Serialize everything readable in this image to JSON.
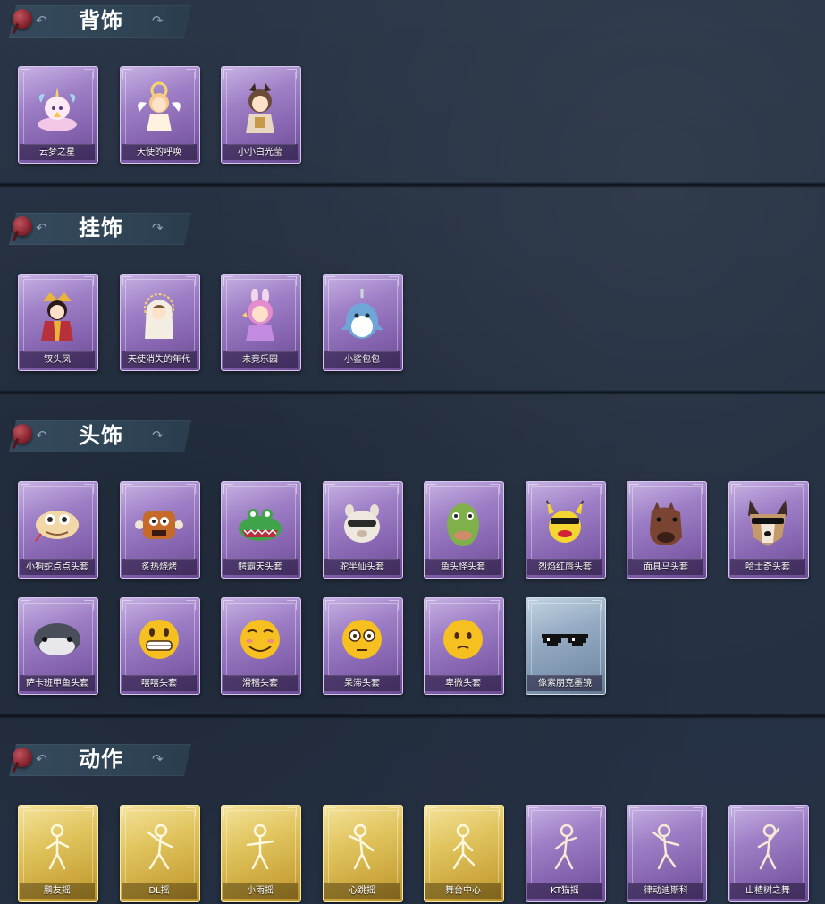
{
  "sections": [
    {
      "title": "背饰",
      "items": [
        "云梦之星",
        "天使的呼唤",
        "小小白光莹"
      ]
    },
    {
      "title": "挂饰",
      "items": [
        "钗头凤",
        "天使消失的年代",
        "未竟乐园",
        "小鲨包包"
      ]
    },
    {
      "title": "头饰",
      "items": [
        "小狗蛇点点头套",
        "炙热烧烤",
        "鳄霸天头套",
        "驼半仙头套",
        "鱼头怪头套",
        "烈焰红唇头套",
        "面具马头套",
        "哈士奇头套",
        "萨卡班甲鱼头套",
        "嘻嘻头套",
        "滑稽头套",
        "呆滞头套",
        "卑微头套",
        "像素朋克墨镜"
      ]
    },
    {
      "title": "动作",
      "items": [
        "鹏友摇",
        "DL摇",
        "小雨摇",
        "心跳摇",
        "舞台中心",
        "KT猫摇",
        "律动迪斯科",
        "山楂树之舞"
      ]
    }
  ],
  "colors": {
    "background": "#263243",
    "rare_frame": "#9e7fc6",
    "legendary_frame": "#e0c35c",
    "common_frame": "#94aac2",
    "pin": "#a33a46"
  },
  "icons": {
    "header_left": "undo-arrow-icon",
    "header_right": "redo-arrow-icon",
    "pin": "pushpin-icon"
  }
}
